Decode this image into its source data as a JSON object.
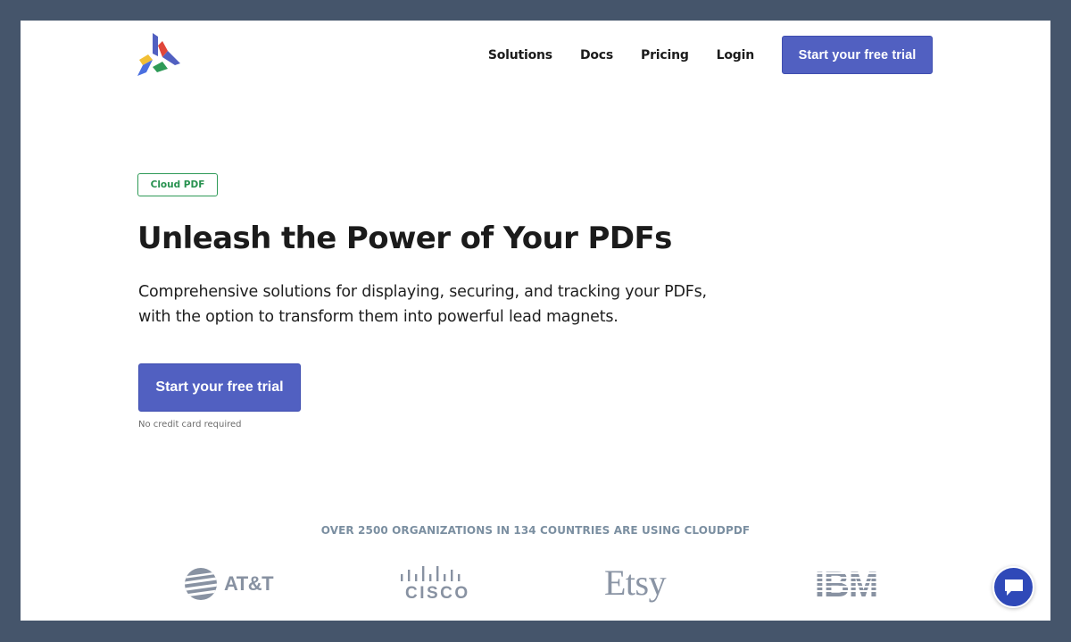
{
  "brand": {
    "logo_icon": "cloudpdf-logo-icon",
    "colors": {
      "primary": "#5160c1",
      "badge_green": "#26914e",
      "muted": "#7b8fa1",
      "frame": "#45556b"
    }
  },
  "nav": {
    "links": [
      {
        "label": "Solutions"
      },
      {
        "label": "Docs"
      },
      {
        "label": "Pricing"
      },
      {
        "label": "Login"
      }
    ],
    "cta_label": "Start your free trial"
  },
  "hero": {
    "badge": "Cloud PDF",
    "title": "Unleash the Power of Your PDFs",
    "subtitle_line1": "Comprehensive solutions for displaying, securing, and tracking your PDFs,",
    "subtitle_line2": "with the option to transform them into powerful lead magnets.",
    "cta_label": "Start your free trial",
    "note": "No credit card required"
  },
  "social_proof": {
    "headline": "OVER 2500 ORGANIZATIONS IN 134 COUNTRIES ARE USING CLOUDPDF",
    "logos": [
      {
        "name": "AT&T",
        "icon": "att-globe-icon"
      },
      {
        "name": "CISCO",
        "icon": "cisco-bars-icon"
      },
      {
        "name": "Etsy",
        "icon": "etsy-wordmark"
      },
      {
        "name": "IBM",
        "icon": "ibm-striped-logo"
      }
    ]
  },
  "chat": {
    "icon": "chat-bubble-icon"
  }
}
